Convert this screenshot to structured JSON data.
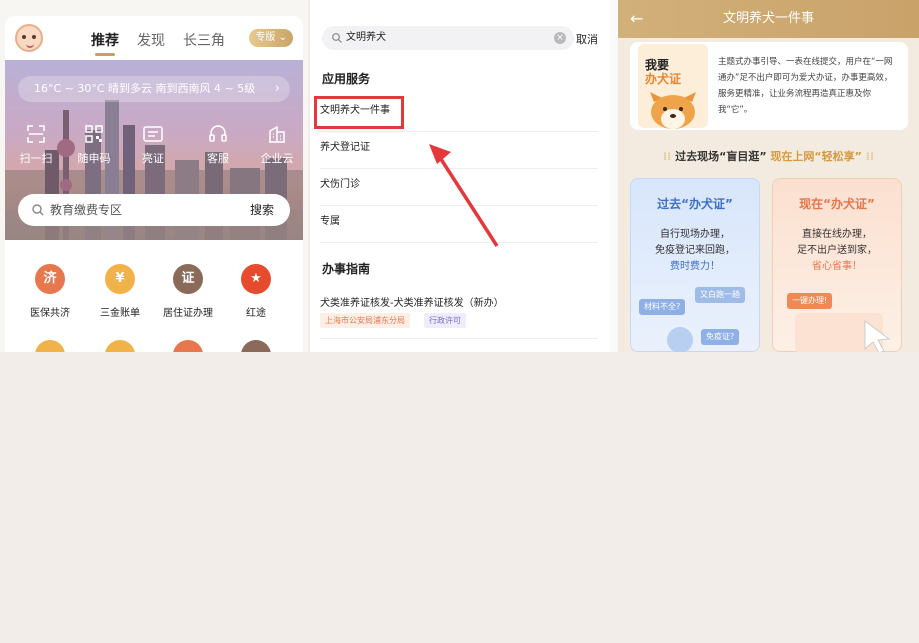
{
  "panel1": {
    "tabs": [
      "推荐",
      "发现",
      "长三角"
    ],
    "edition": "专版",
    "weather": "16°C ~ 30°C 晴到多云 南到西南风 4 ~ 5级",
    "quick_actions": [
      "扫一扫",
      "随申码",
      "亮证",
      "客服",
      "企业云"
    ],
    "search_placeholder": "教育缴费专区",
    "search_button": "搜索",
    "services": [
      {
        "label": "医保共济",
        "color": "#e9774d",
        "glyph": "济"
      },
      {
        "label": "三金账单",
        "color": "#f2b24a",
        "glyph": "¥"
      },
      {
        "label": "居住证办理",
        "color": "#8b6a5a",
        "glyph": "证"
      },
      {
        "label": "红途",
        "color": "#e54b2c",
        "glyph": "★"
      }
    ]
  },
  "panel2": {
    "search_value": "文明养犬",
    "cancel": "取消",
    "section_services": "应用服务",
    "service_rows": [
      "文明养犬一件事",
      "养犬登记证",
      "犬伤门诊",
      "专属"
    ],
    "section_guide": "办事指南",
    "guide_title": "犬类准养证核发-犬类准养证核发（新办）",
    "guide_tags": [
      {
        "label": "上海市公安局浦东分局",
        "color": "#e9774d",
        "bg": "#fdeee6"
      },
      {
        "label": "行政许可",
        "color": "#7a6bd0",
        "bg": "#efecfb"
      }
    ]
  },
  "panel3": {
    "title": "文明养犬一件事",
    "intro_line1": "我要",
    "intro_line2": "办犬证",
    "description": "主题式办事引导、一表在线提交，用户在“一网通办”足不出户即可为爱犬办证，办事更高效，服务更精准，让业务流程再造真正惠及你我“它”。",
    "compare_part1": "过去现场“盲目逛”",
    "compare_part2": "现在上网“轻松享”",
    "past": {
      "title": "过去“办犬证”",
      "line1": "自行现场办理，",
      "line2": "免疫登记来回跑，",
      "line3": "费时费力！",
      "bubbles": [
        "又白跑一趟",
        "材料不全?",
        "免疫证?"
      ]
    },
    "now": {
      "title": "现在“办犬证”",
      "line1": "直接在线办理，",
      "line2": "足不出户送到家，",
      "line3": "省心省事！",
      "bubble": "一键办理!"
    }
  }
}
